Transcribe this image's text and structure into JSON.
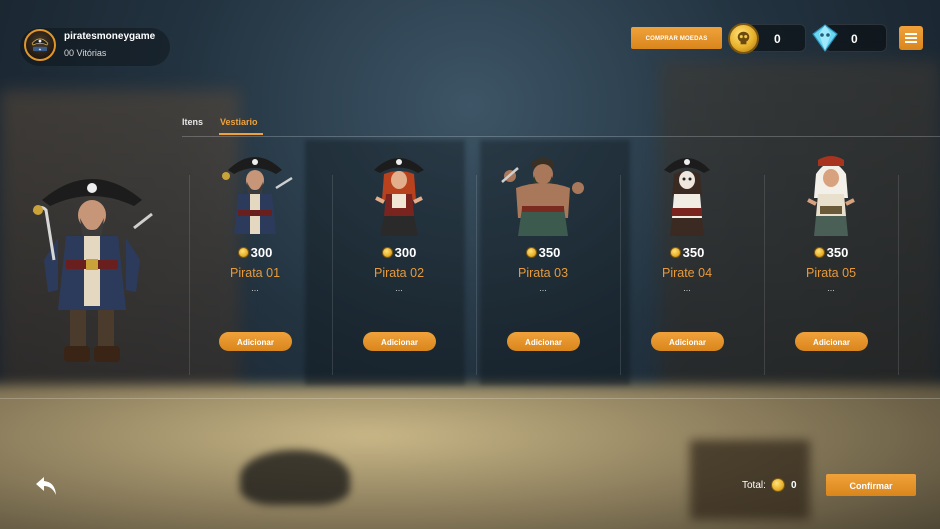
{
  "player": {
    "username": "piratesmoneygame",
    "wins": "00 Vitórias",
    "avatar_icon": "pirate-logo-icon"
  },
  "header": {
    "buy_coins_label": "COMPRAR MOEDAS",
    "gold_coins": "0",
    "gems": "0",
    "gold_icon": "skull-coin-icon",
    "gem_icon": "diamond-gem-icon",
    "menu_icon": "hamburger-menu-icon"
  },
  "tabs": [
    {
      "label": "Itens",
      "active": false
    },
    {
      "label": "Vestiario",
      "active": true
    }
  ],
  "characters": [
    {
      "name": "Pirata 01",
      "price": "300",
      "desc": "...",
      "button": "Adicionar"
    },
    {
      "name": "Pirata 02",
      "price": "300",
      "desc": "...",
      "button": "Adicionar"
    },
    {
      "name": "Pirata 03",
      "price": "350",
      "desc": "...",
      "button": "Adicionar"
    },
    {
      "name": "Pirate 04",
      "price": "350",
      "desc": "...",
      "button": "Adicionar"
    },
    {
      "name": "Pirata 05",
      "price": "350",
      "desc": "...",
      "button": "Adicionar"
    }
  ],
  "footer": {
    "back_icon": "back-arrow-icon",
    "total_label": "Total:",
    "total_value": "0",
    "confirm_label": "Confirmar"
  },
  "colors": {
    "accent": "#f0a23a",
    "button": "#e0922a"
  }
}
